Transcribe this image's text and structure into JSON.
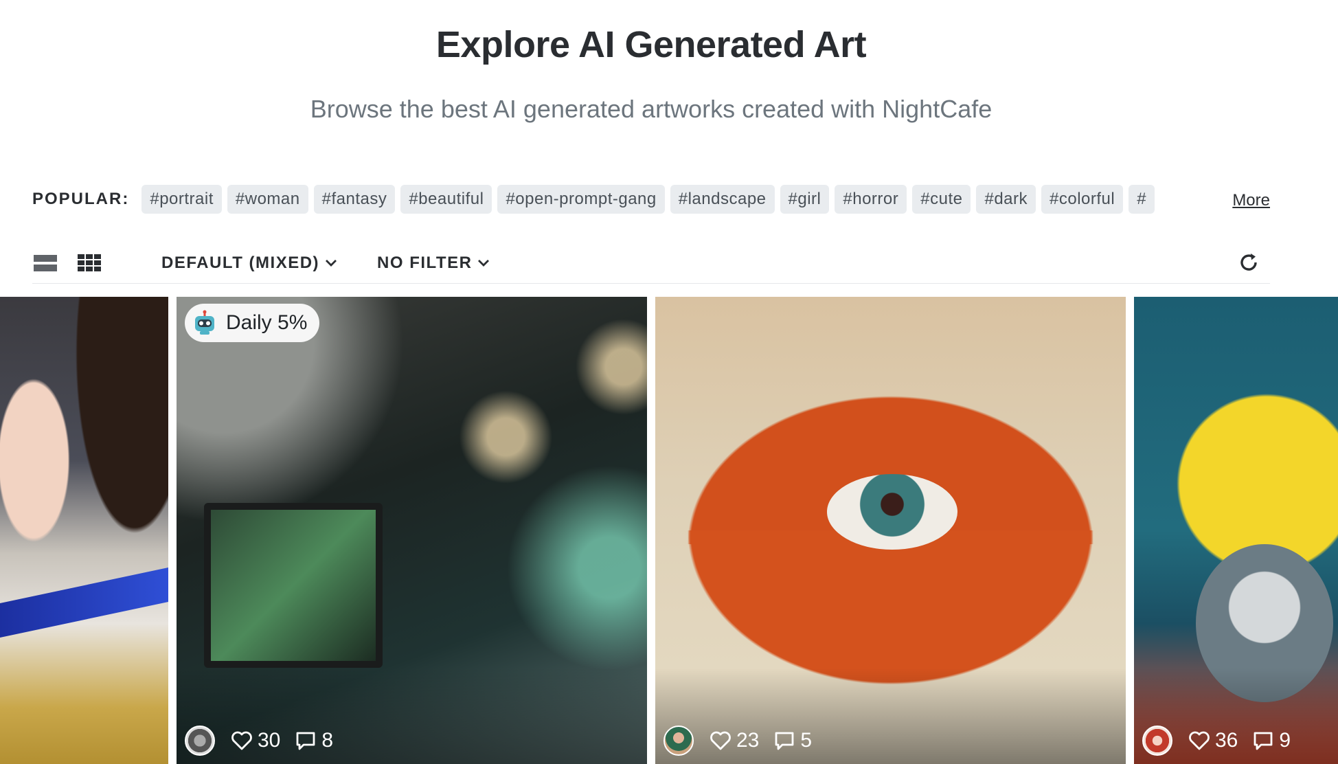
{
  "header": {
    "title": "Explore AI Generated Art",
    "subtitle": "Browse the best AI generated artworks created with NightCafe"
  },
  "popular": {
    "label": "POPULAR:",
    "tags": [
      "#portrait",
      "#woman",
      "#fantasy",
      "#beautiful",
      "#open-prompt-gang",
      "#landscape",
      "#girl",
      "#horror",
      "#cute",
      "#dark",
      "#colorful",
      "#"
    ],
    "more_label": "More"
  },
  "toolbar": {
    "sort_label": "DEFAULT (MIXED)",
    "filter_label": "NO FILTER",
    "view_list_icon": "list-view-icon",
    "view_grid_icon": "grid-view-icon",
    "refresh_icon": "refresh-icon"
  },
  "gallery": {
    "cards": [
      {
        "badge": "",
        "likes": "",
        "comments": ""
      },
      {
        "badge": "Daily 5%",
        "badge_icon": "robot-icon",
        "likes": "30",
        "comments": "8"
      },
      {
        "badge": "",
        "likes": "23",
        "comments": "5"
      },
      {
        "badge": "",
        "likes": "36",
        "comments": "9"
      }
    ]
  },
  "colors": {
    "tag_bg": "#e9ecef",
    "title": "#2a2d31",
    "subtitle": "#6c757d"
  }
}
